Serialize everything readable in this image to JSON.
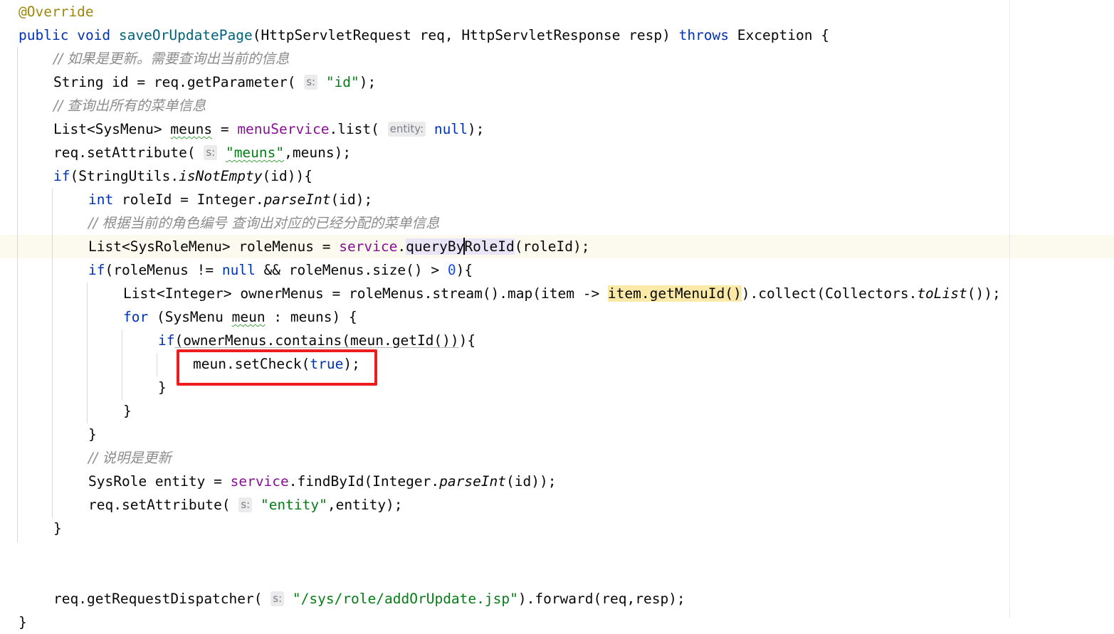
{
  "editor": {
    "language": "Java",
    "method_name": "saveOrUpdatePage",
    "colors": {
      "background": "#ffffff",
      "keyword": "#0033b3",
      "annotation": "#9e880d",
      "method_declaration": "#00627a",
      "field": "#871094",
      "string": "#067d17",
      "number": "#1750eb",
      "comment": "#8c8c8c",
      "caret_line": "#fcf9ef",
      "identifier_highlight": "#eae4f7",
      "usage_highlight": "#fbe9a7",
      "annotation_box": "#ee1c1c",
      "indent_guide": "#d8d8d8",
      "inlay_hint_bg": "#ebebeb",
      "inlay_hint_fg": "#7a7f8c"
    },
    "caret_line_number": 11,
    "caret_position": "between queryBy and RoleId"
  },
  "code_lines": [
    {
      "n": 1,
      "indent": 2,
      "text": "@Override"
    },
    {
      "n": 2,
      "indent": 2,
      "text": "public void saveOrUpdatePage(HttpServletRequest req, HttpServletResponse resp) throws Exception {"
    },
    {
      "n": 3,
      "indent": 6,
      "text": "// 如果是更新。需要查询出当前的信息"
    },
    {
      "n": 4,
      "indent": 6,
      "text": "String id = req.getParameter( s: \"id\");"
    },
    {
      "n": 5,
      "indent": 6,
      "text": "// 查询出所有的菜单信息"
    },
    {
      "n": 6,
      "indent": 6,
      "text": "List<SysMenu> meuns = menuService.list( entity: null);"
    },
    {
      "n": 7,
      "indent": 6,
      "text": "req.setAttribute( s: \"meuns\",meuns);"
    },
    {
      "n": 8,
      "indent": 6,
      "text": "if(StringUtils.isNotEmpty(id)){"
    },
    {
      "n": 9,
      "indent": 10,
      "text": "int roleId = Integer.parseInt(id);"
    },
    {
      "n": 10,
      "indent": 10,
      "text": "// 根据当前的角色编号 查询出对应的已经分配的菜单信息"
    },
    {
      "n": 11,
      "indent": 10,
      "text": "List<SysRoleMenu> roleMenus = service.queryByRoleId(roleId);"
    },
    {
      "n": 12,
      "indent": 10,
      "text": "if(roleMenus != null && roleMenus.size() > 0){"
    },
    {
      "n": 13,
      "indent": 14,
      "text": "List<Integer> ownerMenus = roleMenus.stream().map(item -> item.getMenuId()).collect(Collectors.toList());"
    },
    {
      "n": 14,
      "indent": 14,
      "text": "for (SysMenu meun : meuns) {"
    },
    {
      "n": 15,
      "indent": 18,
      "text": "if(ownerMenus.contains(meun.getId())){"
    },
    {
      "n": 16,
      "indent": 22,
      "text": "meun.setCheck(true);"
    },
    {
      "n": 17,
      "indent": 18,
      "text": "}"
    },
    {
      "n": 18,
      "indent": 14,
      "text": "}"
    },
    {
      "n": 19,
      "indent": 10,
      "text": "}"
    },
    {
      "n": 20,
      "indent": 6,
      "text": "// 说明是更新"
    },
    {
      "n": 21,
      "indent": 6,
      "text": "SysRole entity = service.findById(Integer.parseInt(id));"
    },
    {
      "n": 22,
      "indent": 6,
      "text": "req.setAttribute( s: \"entity\",entity);"
    },
    {
      "n": 23,
      "indent": 2,
      "text": "}"
    },
    {
      "n": 24,
      "indent": 0,
      "text": ""
    },
    {
      "n": 25,
      "indent": 0,
      "text": ""
    },
    {
      "n": 26,
      "indent": 6,
      "text": "req.getRequestDispatcher( s: \"/sys/role/addOrUpdate.jsp\").forward(req,resp);"
    },
    {
      "n": 27,
      "indent": 2,
      "text": "}"
    }
  ],
  "tokens": {
    "annotation_override": "@Override",
    "kw_public": "public",
    "kw_void": "void",
    "method_decl": "saveOrUpdatePage",
    "type_request": "HttpServletRequest",
    "param_req": "req",
    "type_response": "HttpServletResponse",
    "param_resp": "resp",
    "kw_throws": "throws",
    "type_exception": "Exception",
    "comment_1": "// 如果是更新。需要查询出当前的信息",
    "comment_2": "// 查询出所有的菜单信息",
    "comment_3": "// 根据当前的角色编号 查询出对应的已经分配的菜单信息",
    "comment_4": "// 说明是更新",
    "hint_s": "s:",
    "hint_entity": "entity:",
    "str_id": "\"id\"",
    "str_meuns": "\"meuns\"",
    "str_entity": "\"entity\"",
    "str_jsp": "\"/sys/role/addOrUpdate.jsp\"",
    "kw_null": "null",
    "kw_true": "true",
    "num_zero": "0",
    "field_menuService": "menuService",
    "field_service": "service",
    "ident_highlighted": "queryByRoleId",
    "usage_highlighted": "item.getMenuId()",
    "boxed_statement": "meun.setCheck(true);"
  },
  "annotations": [
    {
      "name": "red-highlight-box",
      "shape": "rectangle",
      "color": "#ee1c1c",
      "targets_line": 16,
      "target_text": "meun.setCheck(true);"
    }
  ]
}
